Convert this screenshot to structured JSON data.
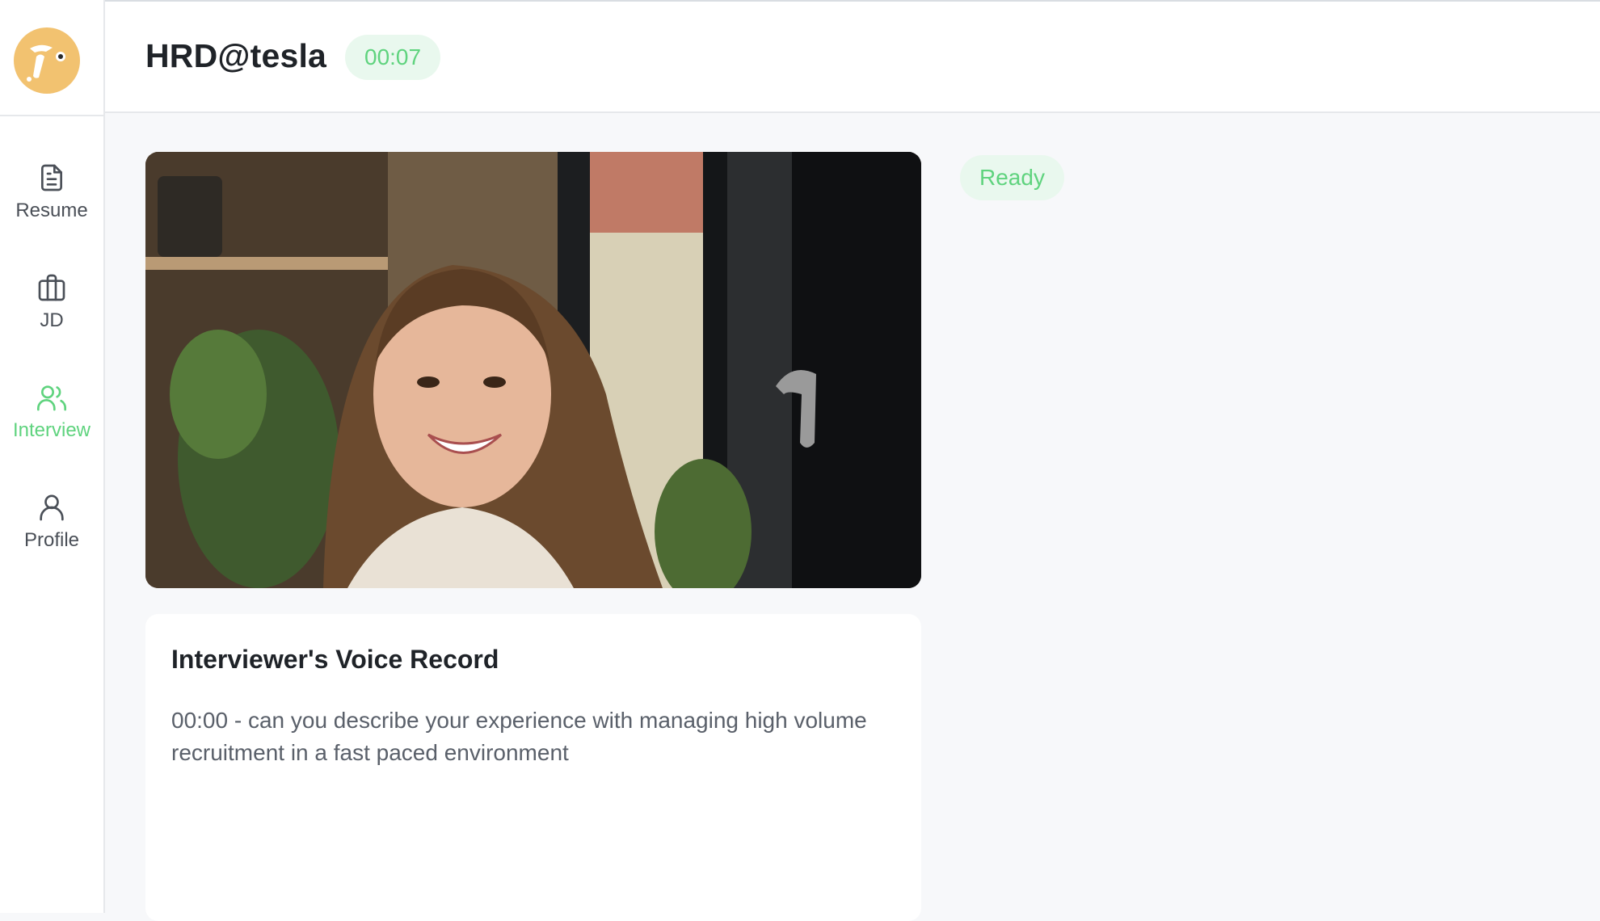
{
  "header": {
    "title": "HRD@tesla",
    "timer": "00:07"
  },
  "sidebar": {
    "logo_icon": "rabbit-logo",
    "items": [
      {
        "label": "Resume",
        "icon": "document-icon",
        "active": false
      },
      {
        "label": "JD",
        "icon": "briefcase-icon",
        "active": false
      },
      {
        "label": "Interview",
        "icon": "users-icon",
        "active": true
      },
      {
        "label": "Profile",
        "icon": "user-icon",
        "active": false
      }
    ]
  },
  "video": {
    "content": "candidate-webcam-feed"
  },
  "status": {
    "label": "Ready"
  },
  "voice_record": {
    "title": "Interviewer's Voice Record",
    "entries": [
      {
        "text": "00:00 - can you describe your experience with managing high volume recruitment in a fast paced environment"
      }
    ]
  },
  "colors": {
    "accent": "#5fd37e",
    "badge_bg": "#e9f8ee",
    "logo": "#f2c270"
  }
}
